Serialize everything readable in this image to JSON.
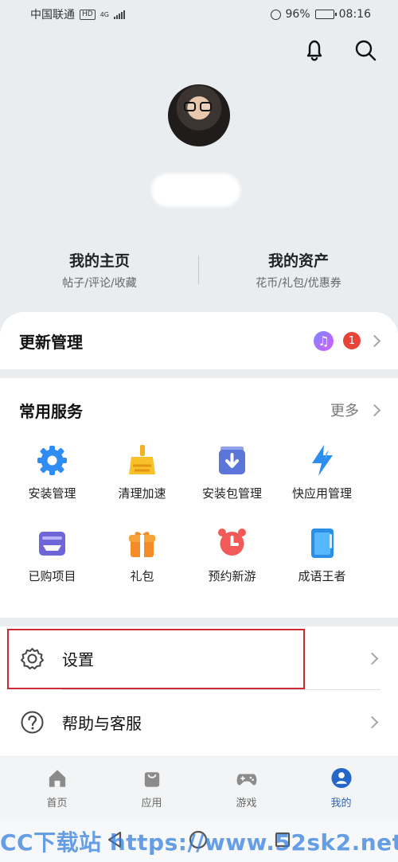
{
  "status_bar": {
    "carrier": "中国联通",
    "hd": "HD",
    "network": "4G",
    "battery_percent": "96%",
    "battery_level": 0.96,
    "time": "08:16"
  },
  "top_actions": {
    "notification_icon": "bell-icon",
    "search_icon": "search-icon"
  },
  "profile": {
    "avatar": "avatar-photo",
    "links": [
      {
        "title": "我的主页",
        "subtitle": "帖子/评论/收藏"
      },
      {
        "title": "我的资产",
        "subtitle": "花币/礼包/优惠券"
      }
    ]
  },
  "update_management": {
    "title": "更新管理",
    "badge_count": "1",
    "app_icon": "music-app-icon",
    "chevron_icon": "chevron-right-icon"
  },
  "services": {
    "title": "常用服务",
    "more_label": "更多",
    "items": [
      {
        "label": "安装管理",
        "icon": "gear-icon",
        "color": "#2f8cf3"
      },
      {
        "label": "清理加速",
        "icon": "broom-icon",
        "color": "#f4b01e"
      },
      {
        "label": "安装包管理",
        "icon": "package-download-icon",
        "color": "#5c75d8"
      },
      {
        "label": "快应用管理",
        "icon": "lightning-icon",
        "color": "#2c8ef0"
      },
      {
        "label": "已购项目",
        "icon": "purchased-icon",
        "color": "#6d65d8"
      },
      {
        "label": "礼包",
        "icon": "gift-icon",
        "color": "#f38b28"
      },
      {
        "label": "预约新游",
        "icon": "alarm-clock-icon",
        "color": "#f25a5a"
      },
      {
        "label": "成语王者",
        "icon": "book-icon",
        "color": "#2b8fe8"
      }
    ]
  },
  "settings": {
    "items": [
      {
        "label": "设置",
        "icon": "gear-outline-icon"
      },
      {
        "label": "帮助与客服",
        "icon": "help-icon"
      }
    ]
  },
  "bottom_nav": {
    "items": [
      {
        "label": "首页",
        "icon": "home-icon"
      },
      {
        "label": "应用",
        "icon": "shopping-bag-icon"
      },
      {
        "label": "游戏",
        "icon": "gamepad-icon"
      },
      {
        "label": "我的",
        "icon": "profile-icon"
      }
    ],
    "active_index": 3,
    "active_color": "#2566c9"
  },
  "system_nav": {
    "back_icon": "back-triangle-icon",
    "home_icon": "home-circle-icon",
    "recent_icon": "recent-square-icon"
  },
  "watermark": {
    "text": "CC下载站 https://www.52sk2.net"
  }
}
